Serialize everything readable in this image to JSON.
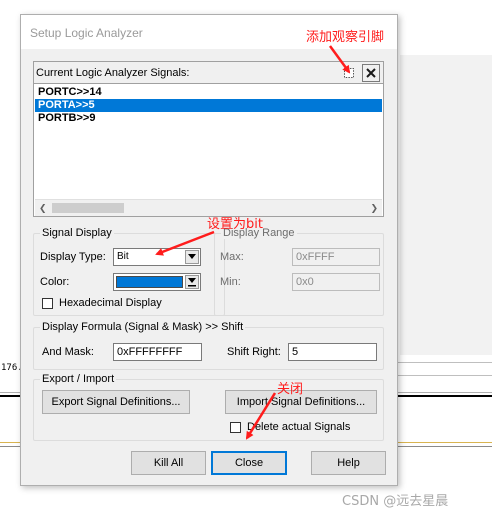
{
  "dialog": {
    "title": "Setup Logic Analyzer",
    "signals": {
      "header": "Current Logic Analyzer Signals:",
      "items": [
        {
          "label": "PORTC>>14",
          "selected": false
        },
        {
          "label": "PORTA>>5",
          "selected": true
        },
        {
          "label": "PORTB>>9",
          "selected": false
        }
      ]
    },
    "signal_display": {
      "title": "Signal Display",
      "display_type_label": "Display Type:",
      "display_type_value": "Bit",
      "color_label": "Color:",
      "color_value": "#0078d7",
      "hex_label": "Hexadecimal Display"
    },
    "display_range": {
      "title": "Display Range",
      "max_label": "Max:",
      "max_value": "0xFFFF",
      "min_label": "Min:",
      "min_value": "0x0"
    },
    "formula": {
      "title": "Display Formula (Signal & Mask) >> Shift",
      "and_mask_label": "And Mask:",
      "and_mask_value": "0xFFFFFFFF",
      "shift_label": "Shift Right:",
      "shift_value": "5"
    },
    "export_import": {
      "title": "Export / Import",
      "export_button": "Export Signal Definitions...",
      "import_button": "Import Signal Definitions...",
      "delete_label": "Delete actual Signals"
    },
    "buttons": {
      "kill_all": "Kill All",
      "close": "Close",
      "help": "Help"
    }
  },
  "background": {
    "strip_label": "176."
  },
  "annotations": {
    "add_pin": "添加观察引脚",
    "set_bit": "设置为bit",
    "close": "关闭",
    "color": "#ff1c1c"
  },
  "watermark": "CSDN @远去星晨"
}
